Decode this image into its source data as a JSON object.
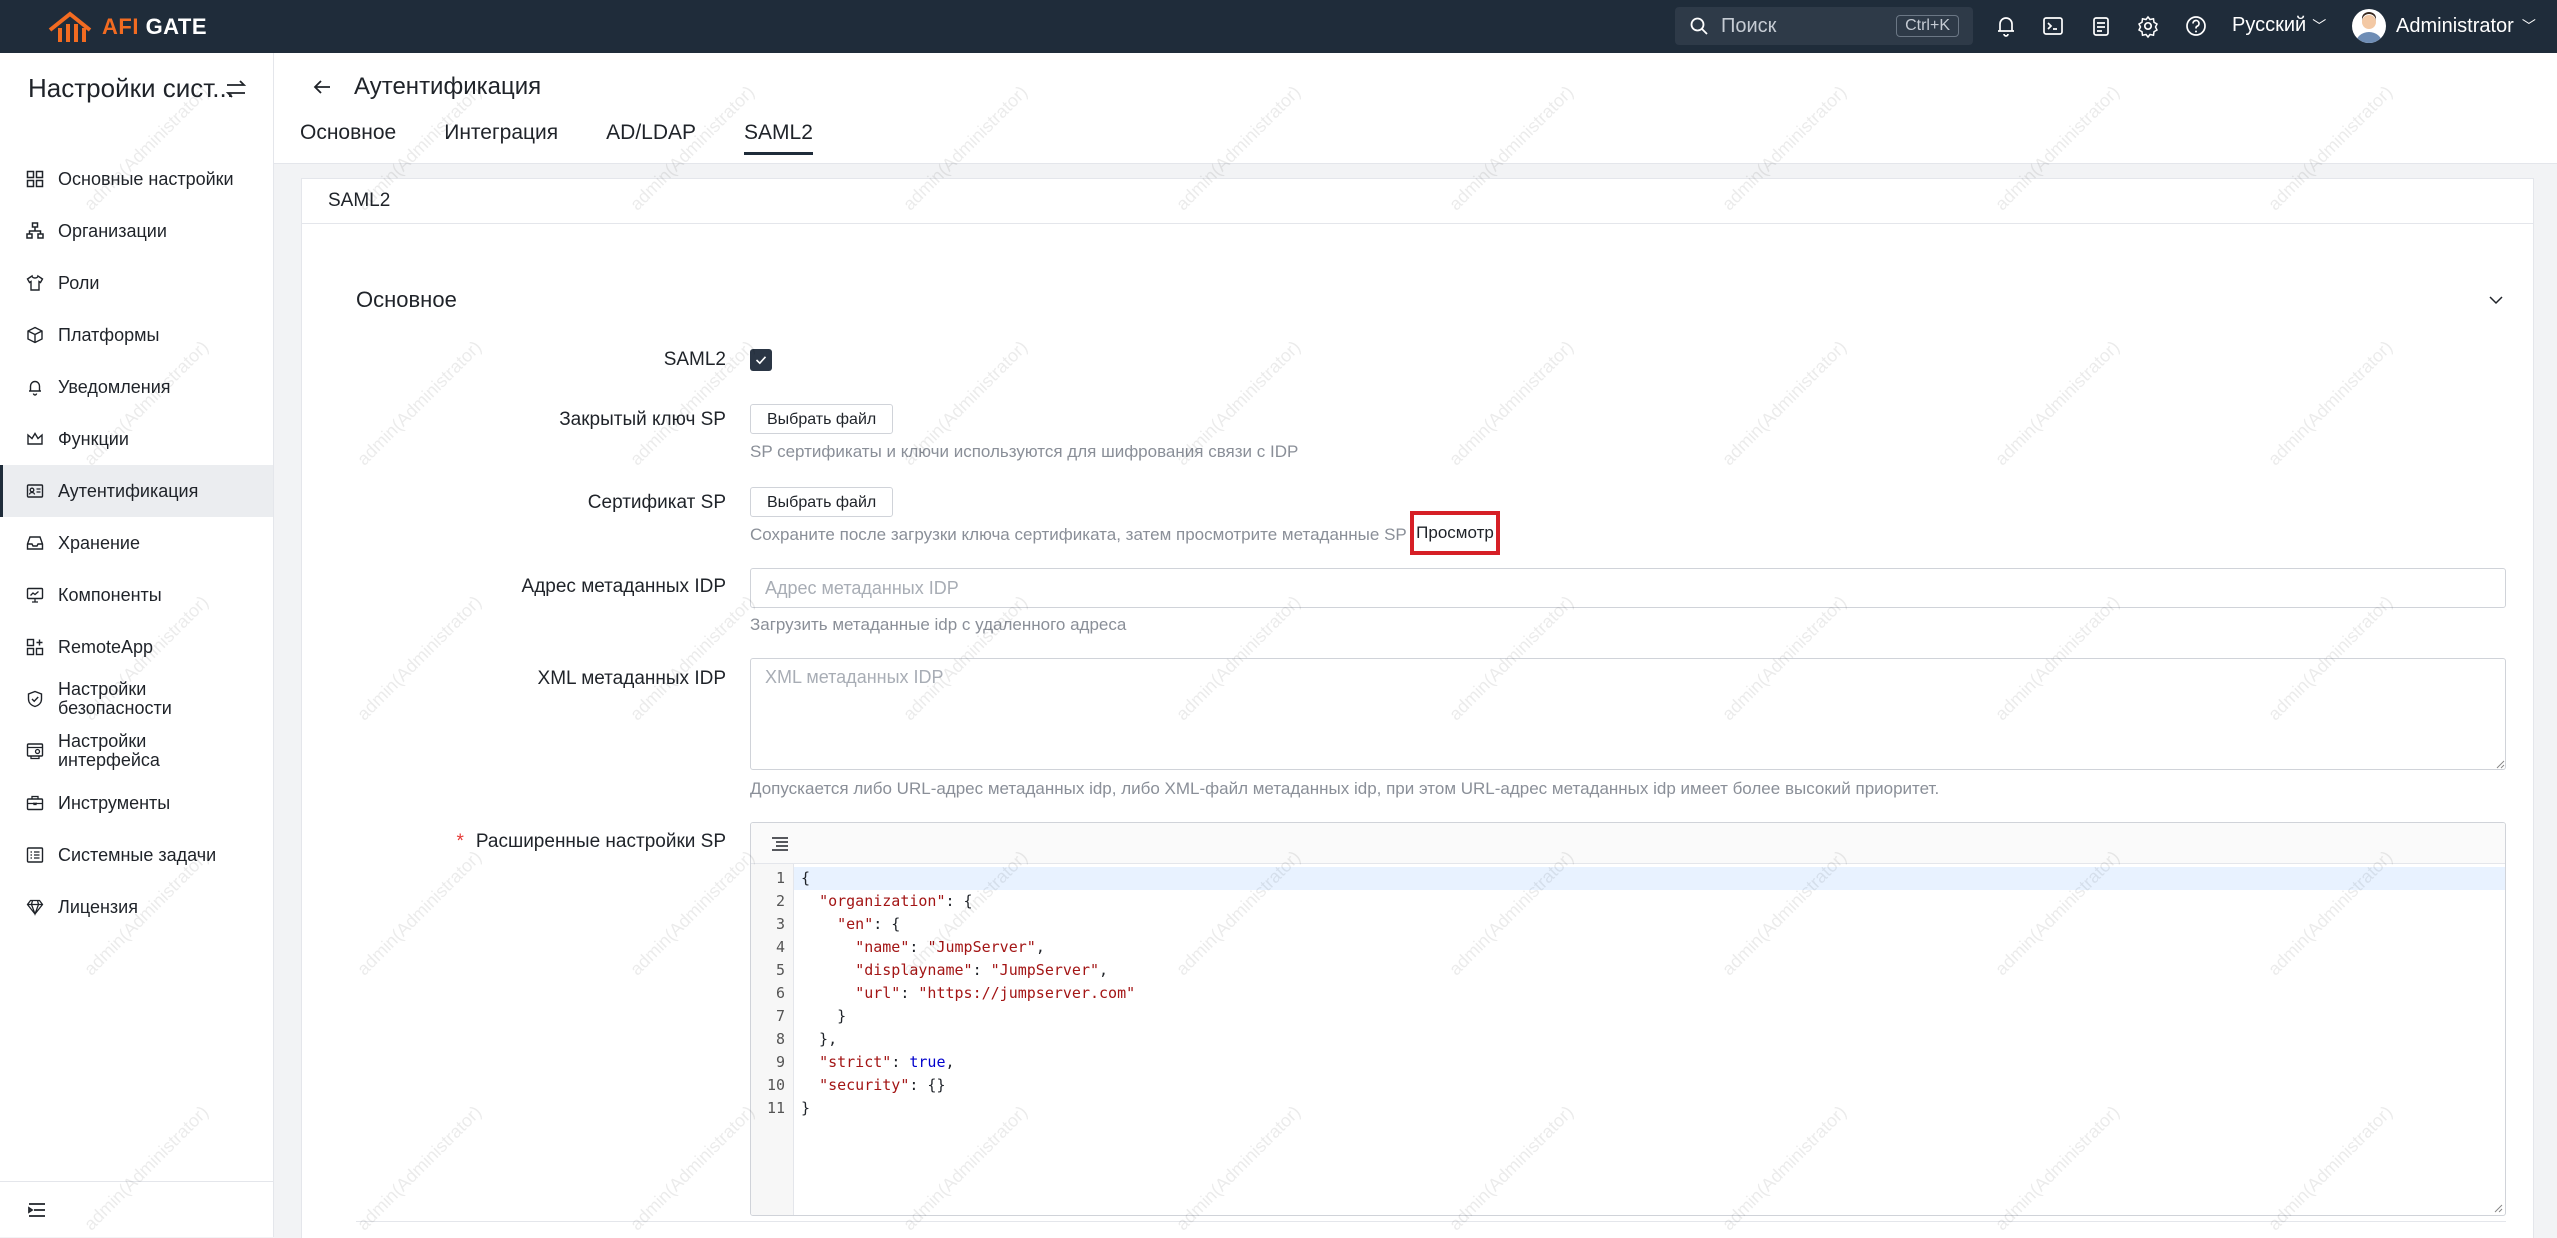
{
  "topbar": {
    "logo_part1": "AFI",
    "logo_part2": " GATE",
    "search_placeholder": "Поиск",
    "search_shortcut": "Ctrl+K",
    "language": "Русский",
    "user_name": "Administrator"
  },
  "sidebar": {
    "title": "Настройки сист...",
    "items": [
      {
        "label": "Основные настройки",
        "icon": "grid-icon"
      },
      {
        "label": "Организации",
        "icon": "org-icon"
      },
      {
        "label": "Роли",
        "icon": "shirt-icon"
      },
      {
        "label": "Платформы",
        "icon": "cube-icon"
      },
      {
        "label": "Уведомления",
        "icon": "bell-icon"
      },
      {
        "label": "Функции",
        "icon": "crown-icon"
      },
      {
        "label": "Аутентификация",
        "icon": "id-card-icon",
        "active": true
      },
      {
        "label": "Хранение",
        "icon": "inbox-icon"
      },
      {
        "label": "Компоненты",
        "icon": "monitor-icon"
      },
      {
        "label": "RemoteApp",
        "icon": "apps-icon"
      },
      {
        "label": "Настройки\nбезопасности",
        "icon": "shield-icon"
      },
      {
        "label": "Настройки\nинтерфейса",
        "icon": "interface-icon"
      },
      {
        "label": "Инструменты",
        "icon": "toolbox-icon"
      },
      {
        "label": "Системные задачи",
        "icon": "tasks-icon"
      },
      {
        "label": "Лицензия",
        "icon": "diamond-icon"
      }
    ]
  },
  "header": {
    "title": "Аутентификация",
    "tabs": [
      {
        "label": "Основное"
      },
      {
        "label": "Интеграция"
      },
      {
        "label": "AD/LDAP"
      },
      {
        "label": "SAML2",
        "active": true
      }
    ]
  },
  "card": {
    "title": "SAML2",
    "section_title": "Основное"
  },
  "form": {
    "saml2_label": "SAML2",
    "sp_key_label": "Закрытый ключ SP",
    "file_button": "Выбрать файл",
    "sp_key_hint": "SP сертификаты и ключи используются для шифрования связи с IDP",
    "sp_cert_label": "Сертификат SP",
    "sp_cert_hint": "Сохраните после загрузки ключа сертификата, затем просмотрите метаданные SP",
    "view_link": "Просмотр",
    "idp_url_label": "Адрес метаданных IDP",
    "idp_url_placeholder": "Адрес метаданных IDP",
    "idp_url_hint": "Загрузить метаданные idp с удаленного адреса",
    "idp_xml_label": "XML метаданных IDP",
    "idp_xml_placeholder": "XML метаданных IDP",
    "idp_xml_hint": "Допускается либо URL-адрес метаданных idp, либо XML-файл метаданных idp, при этом URL-адрес метаданных idp имеет более высокий приоритет.",
    "advanced_label": "Расширенные настройки SP",
    "required_mark": "*"
  },
  "editor": {
    "lines": [
      "{",
      "  \"organization\": {",
      "    \"en\": {",
      "      \"name\": \"JumpServer\",",
      "      \"displayname\": \"JumpServer\",",
      "      \"url\": \"https://jumpserver.com\"",
      "    }",
      "  },",
      "  \"strict\": true,",
      "  \"security\": {}",
      "}"
    ]
  },
  "watermark": "admin(Administrator)",
  "colors": {
    "topbar": "#1f2c3a",
    "accent": "#f26b21",
    "highlight_box": "#d61f26"
  }
}
